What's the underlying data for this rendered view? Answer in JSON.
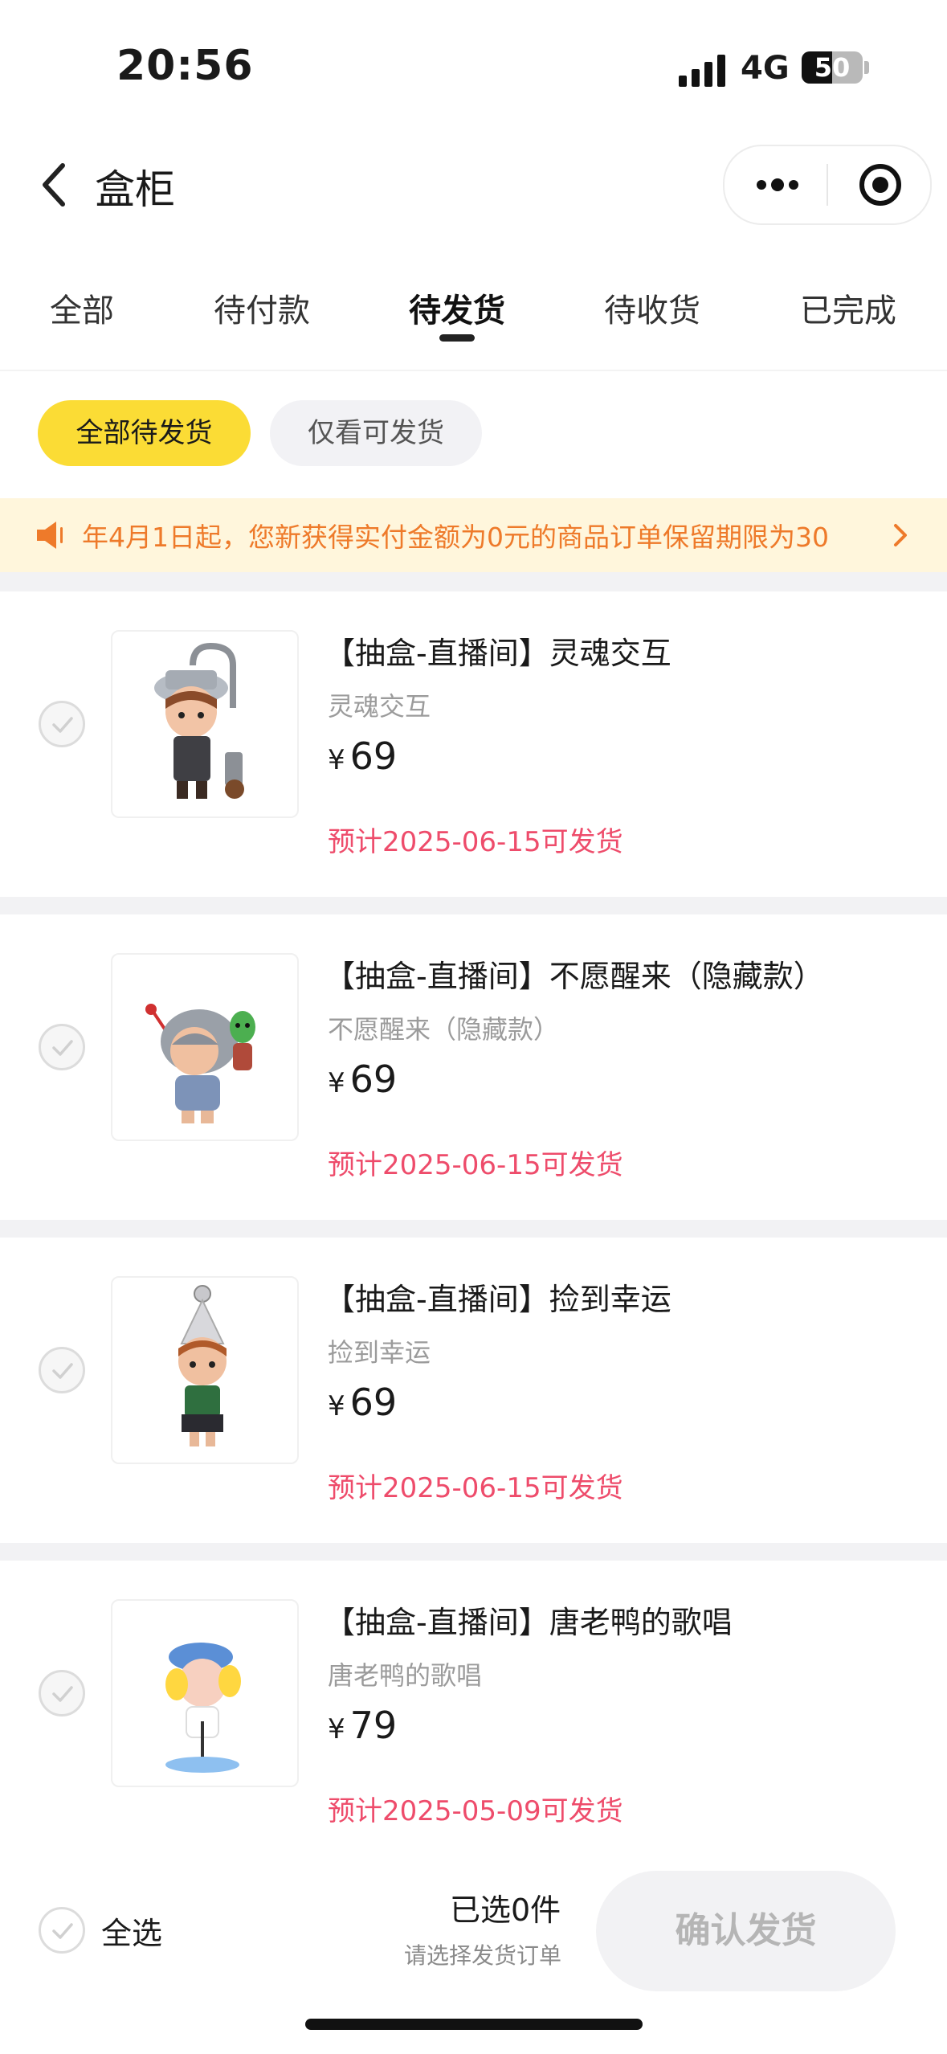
{
  "status_bar": {
    "time": "20:56",
    "network": "4G",
    "battery": "50",
    "battery_fraction": 0.5
  },
  "nav": {
    "title": "盒柜"
  },
  "tabs": [
    {
      "label": "全部"
    },
    {
      "label": "待付款"
    },
    {
      "label": "待发货",
      "active": true
    },
    {
      "label": "待收货"
    },
    {
      "label": "已完成"
    }
  ],
  "filters": {
    "all_pending": "全部待发货",
    "shippable_only": "仅看可发货"
  },
  "notice": {
    "text": "年4月1日起，您新获得实付金额为0元的商品订单保留期限为30"
  },
  "items": [
    {
      "name": "【抽盒-直播间】灵魂交互",
      "variant": "灵魂交互",
      "currency": "¥",
      "price": "69",
      "ship": "预计2025-06-15可发货"
    },
    {
      "name": "【抽盒-直播间】不愿醒来（隐藏款）",
      "variant": "不愿醒来（隐藏款）",
      "currency": "¥",
      "price": "69",
      "ship": "预计2025-06-15可发货"
    },
    {
      "name": "【抽盒-直播间】捡到幸运",
      "variant": "捡到幸运",
      "currency": "¥",
      "price": "69",
      "ship": "预计2025-06-15可发货"
    },
    {
      "name": "【抽盒-直播间】唐老鸭的歌唱",
      "variant": "唐老鸭的歌唱",
      "currency": "¥",
      "price": "79",
      "ship": "预计2025-05-09可发货"
    }
  ],
  "bottom": {
    "select_all": "全选",
    "selected_count": "已选0件",
    "hint": "请选择发货订单",
    "confirm": "确认发货"
  },
  "colors": {
    "accent_yellow": "#fbdc35",
    "ship_pink": "#ee4c6b",
    "notice_orange": "#ee7a2a",
    "notice_bg": "#fff6dc"
  },
  "icons": [
    "back-chevron-icon",
    "more-dots-icon",
    "target-icon",
    "speaker-icon",
    "chevron-right-icon",
    "check-icon"
  ]
}
